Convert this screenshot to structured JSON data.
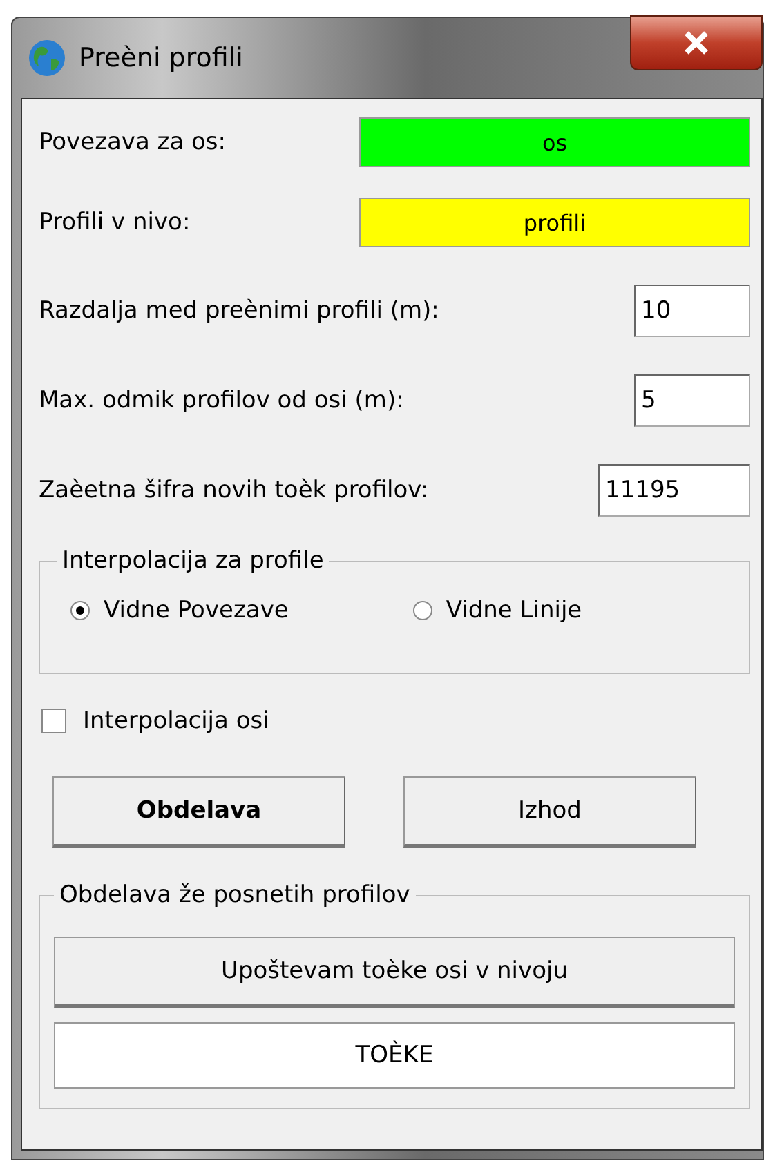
{
  "window": {
    "title": "Preèni profili"
  },
  "layer_fields": [
    {
      "label": "Povezava za os:",
      "value": "os",
      "color": "#00ff00"
    },
    {
      "label": "Profili v nivo:",
      "value": "profili",
      "color": "#ffff00"
    }
  ],
  "number_fields": [
    {
      "label": "Razdalja med preènimi profili (m):",
      "value": "10",
      "wide": false
    },
    {
      "label": "Max. odmik profilov od osi (m):",
      "value": "5",
      "wide": false
    },
    {
      "label": "Zaèetna šifra novih toèk profilov:",
      "value": "11195",
      "wide": true
    }
  ],
  "interpolation_group": {
    "title": "Interpolacija za profile",
    "options": [
      {
        "label": "Vidne Povezave",
        "selected": true
      },
      {
        "label": "Vidne Linije",
        "selected": false
      }
    ]
  },
  "axis_interpolation": {
    "label": "Interpolacija osi",
    "checked": false
  },
  "buttons": [
    {
      "label": "Obdelava",
      "default": true
    },
    {
      "label": "Izhod",
      "default": false
    }
  ],
  "existing_group": {
    "title": "Obdelava že posnetih profilov",
    "button": "Upoštevam toèke osi v nivoju",
    "points_button": "TOÈKE"
  }
}
